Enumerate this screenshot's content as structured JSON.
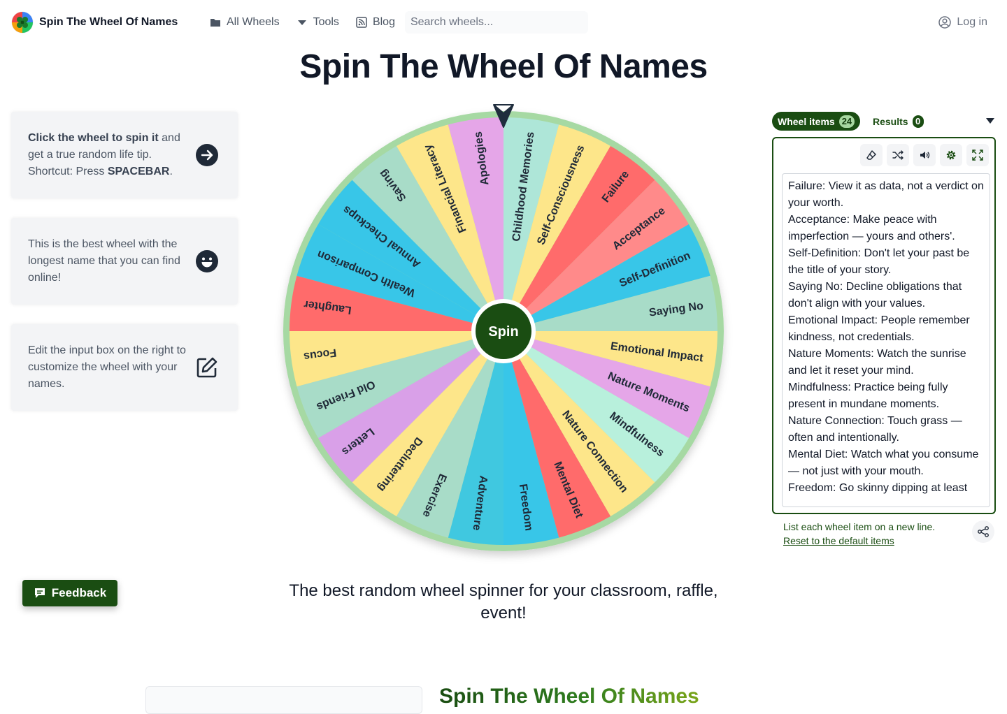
{
  "header": {
    "brand_name": "Spin The Wheel Of Names",
    "nav": [
      {
        "label": "All Wheels",
        "icon": "folder-icon"
      },
      {
        "label": "Tools",
        "icon": "caret-down-icon"
      },
      {
        "label": "Blog",
        "icon": "rss-icon"
      }
    ],
    "search_placeholder": "Search wheels...",
    "login_label": "Log in"
  },
  "page_title": "Spin The Wheel Of Names",
  "cards": [
    {
      "bold": "Click the wheel to spin it",
      "text1": " and get a true random life tip.",
      "text2": "Shortcut: Press ",
      "bold2": "SPACEBAR",
      "text3": ".",
      "icon": "arrow-right-circle-icon"
    },
    {
      "text": "This is the best wheel with the longest name that you can find online!",
      "icon": "smile-icon"
    },
    {
      "text": "Edit the input box on the right to customize the wheel with your names.",
      "icon": "edit-icon"
    }
  ],
  "wheel": {
    "spin_label": "Spin",
    "segments": [
      "Childhood Memories",
      "Self-Consciousness",
      "Failure",
      "Acceptance",
      "Self-Definition",
      "Saying No",
      "Emotional Impact",
      "Nature Moments",
      "Mindfulness",
      "Nature Connection",
      "Mental Diet",
      "Freedom",
      "Adventure",
      "Exercise",
      "Decluttering",
      "Letters",
      "Old Friends",
      "Focus",
      "Laughter",
      "Wealth Comparison",
      "Annual Checkups",
      "Saving",
      "Financial Literacy",
      "Apologies"
    ],
    "colors": [
      "#aee6d8",
      "#fde68a",
      "#ff6b6b",
      "#ff8a8a",
      "#38c6e8",
      "#a8dcc8",
      "#fde68a",
      "#e5a6e8",
      "#b8f0dc",
      "#fde68a",
      "#ff6b6b",
      "#38c6e8",
      "#40c8e0",
      "#a8dcc8",
      "#fde68a",
      "#d9a0e8",
      "#a8dcc8",
      "#fde68a",
      "#ff6b6b",
      "#38c6e8",
      "#38c6e8",
      "#a8dcc8",
      "#fde68a",
      "#e5a6e8"
    ],
    "rim_color": "#a6d9a3"
  },
  "tagline": "The best random wheel spinner for your classroom, raffle, event!",
  "feedback_label": "Feedback",
  "panel": {
    "tab_items_label": "Wheel items",
    "tab_items_count": "24",
    "tab_results_label": "Results",
    "tab_results_count": "0",
    "tools": [
      "eraser-icon",
      "shuffle-icon",
      "volume-icon",
      "gear-icon",
      "fullscreen-icon"
    ],
    "entries": [
      "Failure: View it as data, not a verdict on your worth.",
      "Acceptance: Make peace with imperfection — yours and others'.",
      "Self-Definition: Don't let your past be the title of your story.",
      "Saying No: Decline obligations that don't align with your values.",
      "Emotional Impact: People remember kindness, not credentials.",
      "Nature Moments: Watch the sunrise and let it reset your mind.",
      "Mindfulness: Practice being fully present in mundane moments.",
      "Nature Connection: Touch grass — often and intentionally.",
      "Mental Diet: Watch what you consume — not just with your mouth.",
      "Freedom: Go skinny dipping at least"
    ],
    "hint": "List each wheel item on a new line.",
    "reset_label": "Reset to the default items"
  },
  "bottom_title": "Spin The Wheel Of Names",
  "colors": {
    "brand_green": "#1a4d12",
    "text_dark": "#111827"
  }
}
